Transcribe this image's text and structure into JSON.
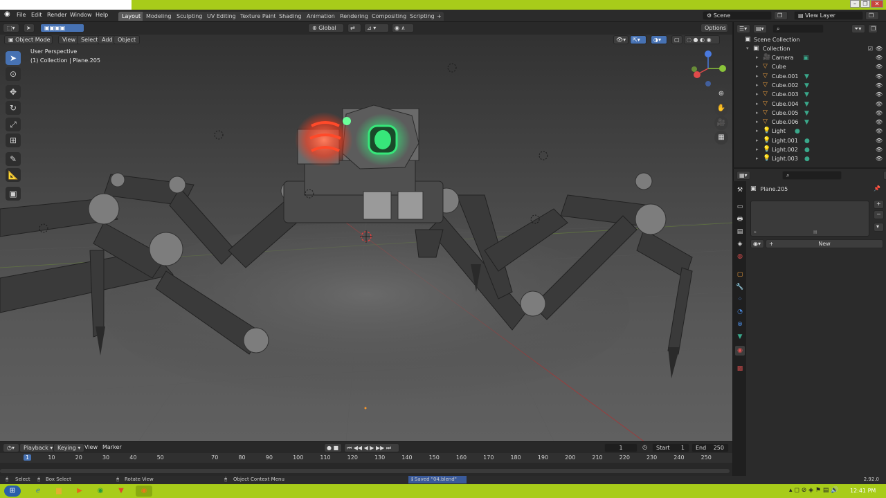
{
  "window": {
    "minimize": "–",
    "restore": "❐",
    "close": "✕"
  },
  "menus": [
    "File",
    "Edit",
    "Render",
    "Window",
    "Help"
  ],
  "workspaces": [
    "Layout",
    "Modeling",
    "Sculpting",
    "UV Editing",
    "Texture Paint",
    "Shading",
    "Animation",
    "Rendering",
    "Compositing",
    "Scripting"
  ],
  "add_workspace": "+",
  "scene": {
    "label": "Scene",
    "view_layer": "View Layer"
  },
  "viewport": {
    "transform_orientation": "Global",
    "options": "Options",
    "mode": "Object Mode",
    "header_menus": [
      "View",
      "Select",
      "Add",
      "Object"
    ],
    "overlay_line1": "User Perspective",
    "overlay_line2": "(1) Collection | Plane.205"
  },
  "outliner": {
    "root": "Scene Collection",
    "collection": "Collection",
    "items": [
      {
        "name": "Camera",
        "type": "camera"
      },
      {
        "name": "Cube",
        "type": "mesh"
      },
      {
        "name": "Cube.001",
        "type": "mesh"
      },
      {
        "name": "Cube.002",
        "type": "mesh"
      },
      {
        "name": "Cube.003",
        "type": "mesh"
      },
      {
        "name": "Cube.004",
        "type": "mesh"
      },
      {
        "name": "Cube.005",
        "type": "mesh"
      },
      {
        "name": "Cube.006",
        "type": "mesh"
      },
      {
        "name": "Light",
        "type": "light"
      },
      {
        "name": "Light.001",
        "type": "light"
      },
      {
        "name": "Light.002",
        "type": "light"
      },
      {
        "name": "Light.003",
        "type": "light"
      }
    ]
  },
  "properties": {
    "object_name": "Plane.205",
    "new_button": "New",
    "add_icon": "+",
    "remove_icon": "−"
  },
  "timeline": {
    "menus": [
      "Playback",
      "Keying",
      "View",
      "Marker"
    ],
    "current_frame": "1",
    "start_label": "Start",
    "start": "1",
    "end_label": "End",
    "end": "250",
    "ticks": [
      "1",
      "10",
      "20",
      "30",
      "40",
      "50",
      "70",
      "80",
      "90",
      "100",
      "110",
      "120",
      "130",
      "140",
      "150",
      "160",
      "170",
      "180",
      "190",
      "200",
      "210",
      "220",
      "230",
      "240",
      "250"
    ]
  },
  "status": {
    "select": "Select",
    "box_select": "Box Select",
    "rotate_view": "Rotate View",
    "context_menu": "Object Context Menu",
    "saved_msg": "Saved \"04.blend\"",
    "version": "2.92.0"
  },
  "taskbar": {
    "time": "12:41 PM"
  },
  "colors": {
    "accent": "#4772b3",
    "green_glow": "#37e67a",
    "red_glow": "#ff4a2a",
    "taskbar": "#a8cc1a"
  }
}
